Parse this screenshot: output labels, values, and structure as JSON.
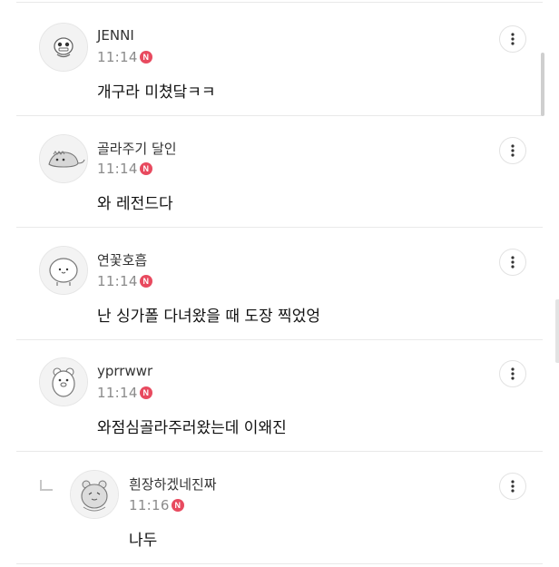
{
  "comments": [
    {
      "nickname": "JENNI",
      "time": "11:14",
      "badge": "N",
      "text": "개구라 미쳤닼ㅋㅋ",
      "avatar_icon": "cartoon-character-icon"
    },
    {
      "nickname": "골라주기 달인",
      "time": "11:14",
      "badge": "N",
      "text": "와 레전드다",
      "avatar_icon": "dinosaur-character-icon"
    },
    {
      "nickname": "연꽃호흡",
      "time": "11:14",
      "badge": "N",
      "text": "난 싱가폴 다녀왔을 때 도장 찍었엉",
      "avatar_icon": "round-blob-character-icon"
    },
    {
      "nickname": "yprrwwr",
      "time": "11:14",
      "badge": "N",
      "text": "와점심골라주러왔는데 이왜진",
      "avatar_icon": "bear-character-icon"
    }
  ],
  "reply": {
    "nickname": "흰장하겠네진짜",
    "time": "11:16",
    "badge": "N",
    "text": "나두",
    "avatar_icon": "hamster-character-icon"
  },
  "colors": {
    "badge": "#e84a5f",
    "divider": "#e9e9e9",
    "time": "#8b8b8b"
  }
}
